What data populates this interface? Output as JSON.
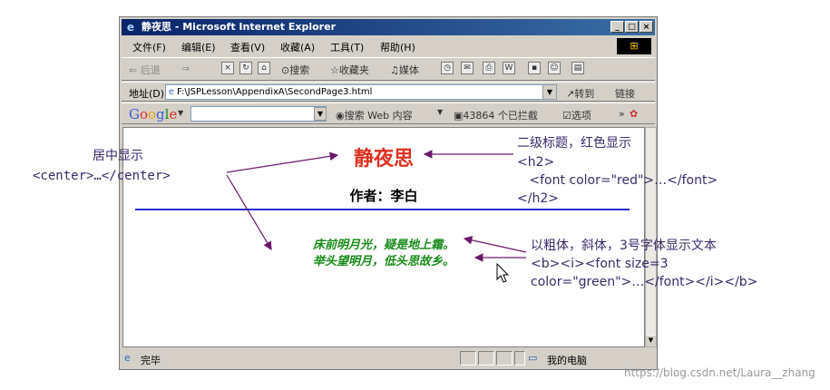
{
  "window": {
    "title": "静夜思 - Microsoft Internet Explorer",
    "controls": {
      "minimize": "_",
      "maximize": "□",
      "close": "×"
    }
  },
  "menubar": [
    "文件(F)",
    "编辑(E)",
    "查看(V)",
    "收藏(A)",
    "工具(T)",
    "帮助(H)"
  ],
  "toolbar": {
    "back": "⇐ 后退",
    "forward": "⇒",
    "search": "搜索",
    "favorites": "收藏夹",
    "media": "媒体"
  },
  "addressbar": {
    "label": "地址(D)",
    "url": "F:\\JSPLesson\\AppendixA\\SecondPage3.html",
    "go": "转到",
    "links": "链接"
  },
  "googlebar": {
    "logo": "Google",
    "search_web": "搜索 Web 内容",
    "blocked": "43864 个已拦截",
    "options": "选项"
  },
  "page": {
    "heading": "静夜思",
    "author": "作者：李白",
    "poem_line1": "床前明月光，疑是地上霜。",
    "poem_line2": "举头望明月，低头思故乡。"
  },
  "statusbar": {
    "status": "完毕",
    "zone": "我的电脑"
  },
  "annotations": {
    "center_title": "居中显示",
    "center_code": "<center>…</center>",
    "h2_title": "二级标题，红色显示",
    "h2_code_1": "<h2>",
    "h2_code_2": "   <font color=\"red\">…</font>",
    "h2_code_3": "</h2>",
    "bold_title": "以粗体，斜体，3号字体显示文本",
    "bold_code_1": "<b><i><font size=3",
    "bold_code_2": "color=\"green\">…</font></i></b>"
  },
  "watermark": "https://blog.csdn.net/Laura__zhang",
  "colors": {
    "title_bar": "#0a246a",
    "heading_red": "#e03020",
    "poem_green": "#1a8c1a",
    "rule_blue": "#2a2ad0",
    "annotation": "#3a2a6a",
    "arrow": "#6a1a6a"
  }
}
